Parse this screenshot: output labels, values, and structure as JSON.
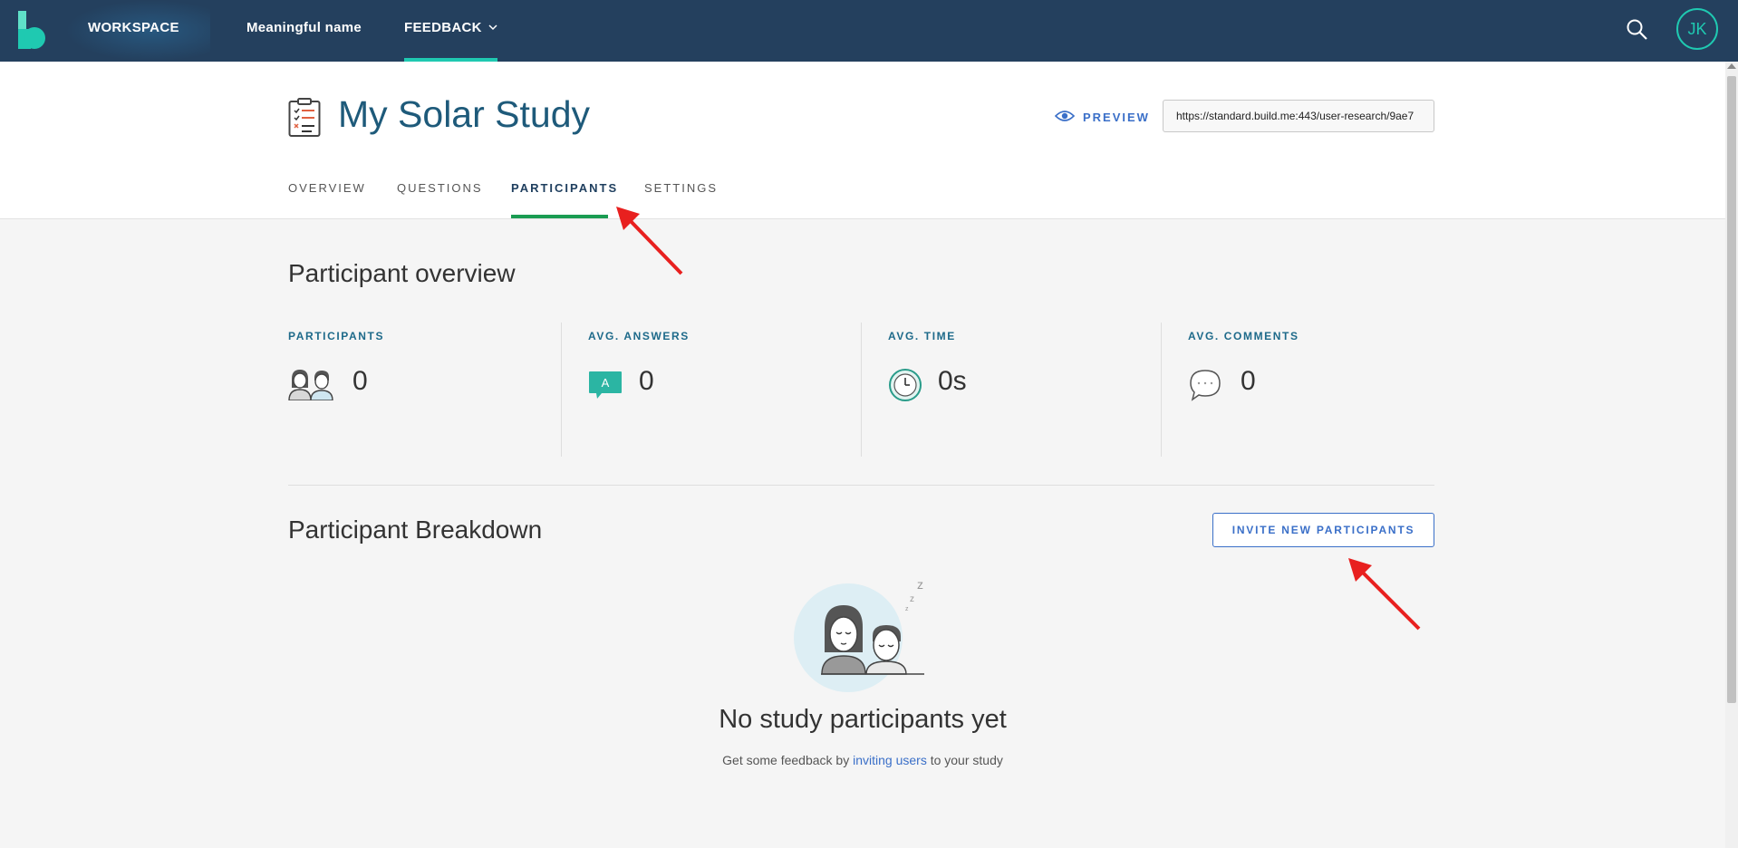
{
  "topnav": {
    "items": [
      {
        "label": "WORKSPACE"
      },
      {
        "label": "Meaningful name"
      },
      {
        "label": "FEEDBACK"
      }
    ],
    "avatar_initials": "JK",
    "accent_color": "#1fc9b1",
    "bar_color": "#24405e"
  },
  "study": {
    "title": "My Solar Study",
    "preview_label": "PREVIEW",
    "url": "https://standard.build.me:443/user-research/9ae7"
  },
  "tabs": [
    {
      "label": "OVERVIEW",
      "active": false
    },
    {
      "label": "QUESTIONS",
      "active": false
    },
    {
      "label": "PARTICIPANTS",
      "active": true
    },
    {
      "label": "SETTINGS",
      "active": false
    }
  ],
  "overview": {
    "title": "Participant overview",
    "stats": [
      {
        "label": "PARTICIPANTS",
        "value": "0",
        "icon": "participants-icon"
      },
      {
        "label": "AVG. ANSWERS",
        "value": "0",
        "icon": "answer-icon",
        "icon_text": "A"
      },
      {
        "label": "AVG. TIME",
        "value": "0s",
        "icon": "clock-icon"
      },
      {
        "label": "AVG. COMMENTS",
        "value": "0",
        "icon": "comment-icon"
      }
    ]
  },
  "breakdown": {
    "title": "Participant Breakdown",
    "invite_label": "INVITE NEW PARTICIPANTS",
    "empty_title": "No study participants yet",
    "empty_sub_before": "Get some feedback by ",
    "empty_sub_link": "inviting users",
    "empty_sub_after": " to your study"
  },
  "colors": {
    "active_tab_underline": "#1a9c52",
    "link": "#3a6fc8",
    "annotation_arrow": "#e8201f"
  }
}
